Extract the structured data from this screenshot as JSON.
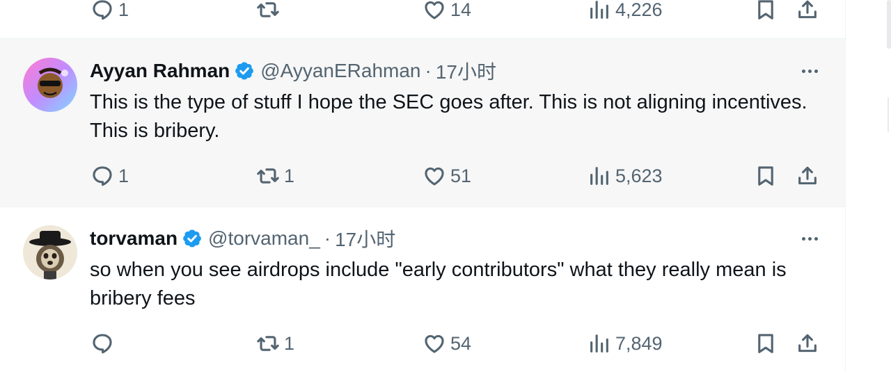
{
  "previous_tweet": {
    "actions": {
      "reply_count": "1",
      "retweet_count": "",
      "like_count": "14",
      "view_count": "4,226"
    }
  },
  "tweets": [
    {
      "display_name": "Ayyan Rahman",
      "handle": "@AyyanERahman",
      "separator": "·",
      "time": "17小时",
      "text": "This is the type of stuff I hope the SEC goes after. This is not aligning incentives. This is bribery.",
      "reply_count": "1",
      "retweet_count": "1",
      "like_count": "51",
      "view_count": "5,623"
    },
    {
      "display_name": "torvaman",
      "handle": "@torvaman_",
      "separator": "·",
      "time": "17小时",
      "text": "so when you see airdrops include \"early contributors\" what they really mean is bribery fees",
      "reply_count": "",
      "retweet_count": "1",
      "like_count": "54",
      "view_count": "7,849"
    }
  ],
  "icons": {
    "reply": "reply-icon",
    "retweet": "retweet-icon",
    "like": "heart-icon",
    "views": "views-icon",
    "bookmark": "bookmark-icon",
    "share": "share-icon",
    "verified": "verified-badge-icon",
    "more": "more-options-icon"
  },
  "colors": {
    "verified_blue": "#1d9bf0",
    "secondary_text": "#536471",
    "hover_background": "#f7f7f7"
  }
}
